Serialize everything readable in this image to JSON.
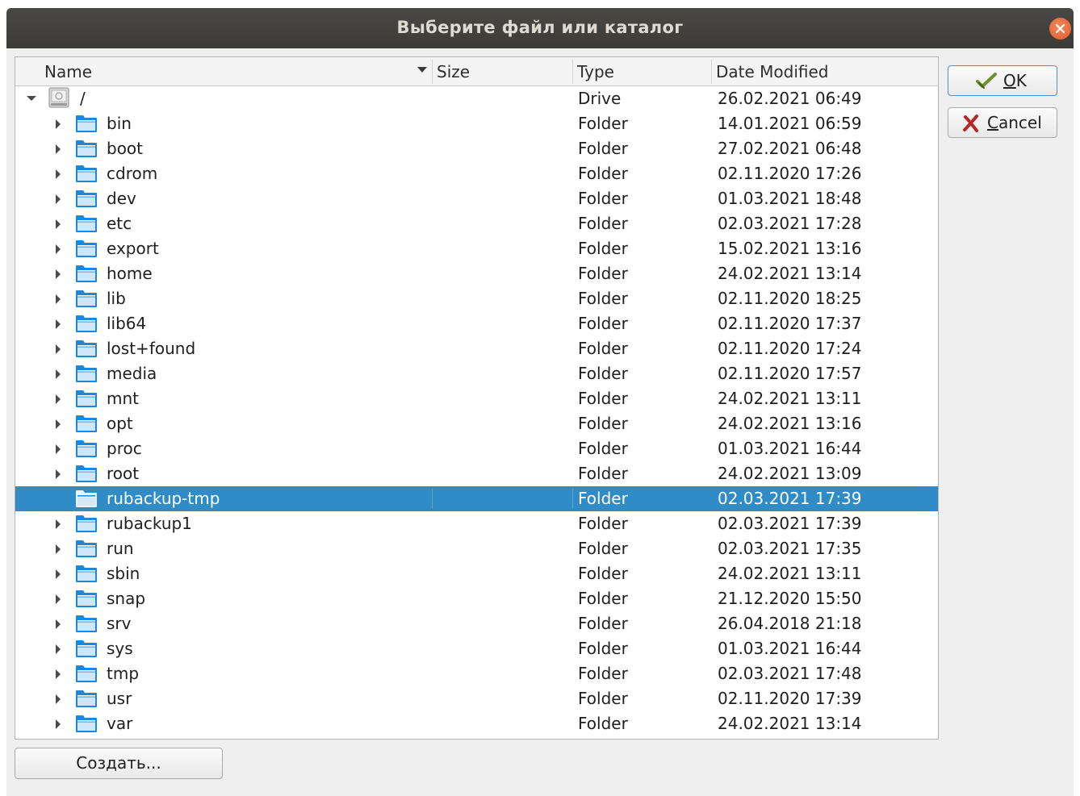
{
  "window": {
    "title": "Выберите файл или каталог"
  },
  "columns": {
    "name": "Name",
    "size": "Size",
    "type": "Type",
    "date": "Date Modified"
  },
  "rows": [
    {
      "name": "/",
      "type": "Drive",
      "date": "26.02.2021 06:49",
      "icon": "drive-icon",
      "expander": "expanded"
    },
    {
      "name": "bin",
      "type": "Folder",
      "date": "14.01.2021 06:59",
      "icon": "folder-icon",
      "expander": "collapsed"
    },
    {
      "name": "boot",
      "type": "Folder",
      "date": "27.02.2021 06:48",
      "icon": "folder-icon",
      "expander": "collapsed"
    },
    {
      "name": "cdrom",
      "type": "Folder",
      "date": "02.11.2020 17:26",
      "icon": "folder-icon",
      "expander": "collapsed"
    },
    {
      "name": "dev",
      "type": "Folder",
      "date": "01.03.2021 18:48",
      "icon": "folder-icon",
      "expander": "collapsed"
    },
    {
      "name": "etc",
      "type": "Folder",
      "date": "02.03.2021 17:28",
      "icon": "folder-icon",
      "expander": "collapsed"
    },
    {
      "name": "export",
      "type": "Folder",
      "date": "15.02.2021 13:16",
      "icon": "folder-icon",
      "expander": "collapsed"
    },
    {
      "name": "home",
      "type": "Folder",
      "date": "24.02.2021 13:14",
      "icon": "folder-icon",
      "expander": "collapsed"
    },
    {
      "name": "lib",
      "type": "Folder",
      "date": "02.11.2020 18:25",
      "icon": "folder-icon",
      "expander": "collapsed"
    },
    {
      "name": "lib64",
      "type": "Folder",
      "date": "02.11.2020 17:37",
      "icon": "folder-icon",
      "expander": "collapsed"
    },
    {
      "name": "lost+found",
      "type": "Folder",
      "date": "02.11.2020 17:24",
      "icon": "folder-icon",
      "expander": "collapsed"
    },
    {
      "name": "media",
      "type": "Folder",
      "date": "02.11.2020 17:57",
      "icon": "folder-icon",
      "expander": "collapsed"
    },
    {
      "name": "mnt",
      "type": "Folder",
      "date": "24.02.2021 13:11",
      "icon": "folder-icon",
      "expander": "collapsed"
    },
    {
      "name": "opt",
      "type": "Folder",
      "date": "24.02.2021 13:16",
      "icon": "folder-icon",
      "expander": "collapsed"
    },
    {
      "name": "proc",
      "type": "Folder",
      "date": "01.03.2021 16:44",
      "icon": "folder-icon",
      "expander": "collapsed"
    },
    {
      "name": "root",
      "type": "Folder",
      "date": "24.02.2021 13:09",
      "icon": "folder-icon",
      "expander": "collapsed"
    },
    {
      "name": "rubackup-tmp",
      "type": "Folder",
      "date": "02.03.2021 17:39",
      "icon": "folder-icon",
      "expander": "none",
      "selected": true
    },
    {
      "name": "rubackup1",
      "type": "Folder",
      "date": "02.03.2021 17:39",
      "icon": "folder-icon",
      "expander": "collapsed"
    },
    {
      "name": "run",
      "type": "Folder",
      "date": "02.03.2021 17:35",
      "icon": "folder-icon",
      "expander": "collapsed"
    },
    {
      "name": "sbin",
      "type": "Folder",
      "date": "24.02.2021 13:11",
      "icon": "folder-icon",
      "expander": "collapsed"
    },
    {
      "name": "snap",
      "type": "Folder",
      "date": "21.12.2020 15:50",
      "icon": "folder-icon",
      "expander": "collapsed"
    },
    {
      "name": "srv",
      "type": "Folder",
      "date": "26.04.2018 21:18",
      "icon": "folder-icon",
      "expander": "collapsed"
    },
    {
      "name": "sys",
      "type": "Folder",
      "date": "01.03.2021 16:44",
      "icon": "folder-icon",
      "expander": "collapsed"
    },
    {
      "name": "tmp",
      "type": "Folder",
      "date": "02.03.2021 17:48",
      "icon": "folder-icon",
      "expander": "collapsed"
    },
    {
      "name": "usr",
      "type": "Folder",
      "date": "02.11.2020 17:39",
      "icon": "folder-icon",
      "expander": "collapsed"
    },
    {
      "name": "var",
      "type": "Folder",
      "date": "24.02.2021 13:14",
      "icon": "folder-icon",
      "expander": "collapsed"
    }
  ],
  "buttons": {
    "ok": {
      "mnemonic": "O",
      "rest": "K"
    },
    "cancel": {
      "mnemonic": "C",
      "rest": "ancel"
    },
    "create": "Создать..."
  },
  "colors": {
    "selection": "#308cc6",
    "folder": "#1e88d8",
    "titlebar": "#3c3b37",
    "close": "#e35a2a"
  }
}
